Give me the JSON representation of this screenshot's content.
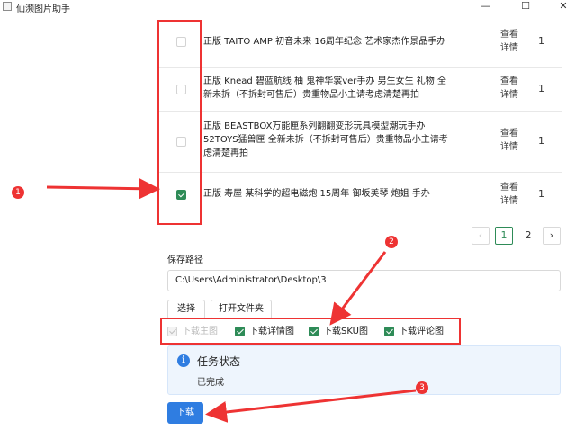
{
  "window": {
    "title": "仙濒图片助手",
    "minimize_icon": "minimize-icon",
    "maximize_icon": "maximize-icon",
    "close_icon": "close-icon",
    "minimize_glyph": "—",
    "maximize_glyph": "☐",
    "close_glyph": "✕"
  },
  "products": {
    "rows": [
      {
        "title_lines": [
          "正版 TAITO AMP 初音未来 16周年纪念 艺术家杰作景品手办"
        ],
        "link": "查看详情",
        "quantity": "1",
        "checked": false
      },
      {
        "title_lines": [
          "正版 Knead 碧蓝航线 柚 鬼神华裳ver手办 男生女生 礼物 全",
          "新未拆（不拆封可售后）贵重物品小主请考虑清楚再拍"
        ],
        "link": "查看详情",
        "quantity": "1",
        "checked": false
      },
      {
        "title_lines": [
          "正版 BEASTBOX万能匣系列翻翻变形玩具模型潮玩手办",
          "52TOYS猛兽匣 全新未拆（不拆封可售后）贵重物品小主请考",
          "虑清楚再拍"
        ],
        "link": "查看详情",
        "quantity": "1",
        "checked": false
      },
      {
        "title_lines": [
          "正版 寿屋 某科学的超电磁炮 15周年 御坂美琴 炮姐 手办"
        ],
        "link": "查看详情",
        "quantity": "1",
        "checked": true
      }
    ]
  },
  "pagination": {
    "prev": "‹",
    "pages": [
      "1",
      "2"
    ],
    "current": "1",
    "next": "›"
  },
  "save_path": {
    "label": "保存路径",
    "value": "C:\\Users\\Administrator\\Desktop\\3",
    "choose_button": "选择",
    "open_folder_button": "打开文件夹"
  },
  "download_options": [
    {
      "label": "下载主图",
      "checked": true,
      "disabled": true
    },
    {
      "label": "下载详情图",
      "checked": true,
      "disabled": false
    },
    {
      "label": "下载SKU图",
      "checked": true,
      "disabled": false
    },
    {
      "label": "下载评论图",
      "checked": true,
      "disabled": false
    }
  ],
  "task_status": {
    "info_icon": "info-icon",
    "info_glyph": "i",
    "title": "任务状态",
    "text": "已完成"
  },
  "download_button": "下载",
  "annotations": {
    "markers": [
      "1",
      "2",
      "3"
    ],
    "color": "#e33333"
  },
  "colors": {
    "accent_blue": "#2f7de1",
    "check_green": "#2e8b57",
    "status_bg": "#eef5fd"
  }
}
